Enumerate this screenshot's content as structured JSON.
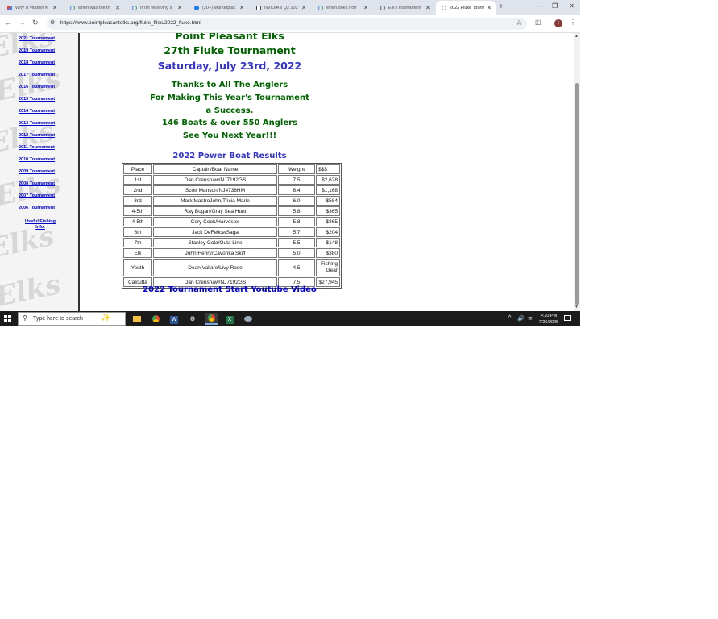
{
  "browser": {
    "tabs": [
      {
        "title": "Why is vitamin K",
        "icon": "gmail-icon"
      },
      {
        "title": "when was the th",
        "icon": "google-icon"
      },
      {
        "title": "If I'm receiving s",
        "icon": "google-icon"
      },
      {
        "title": "(20+) Marketplac",
        "icon": "facebook-icon"
      },
      {
        "title": "NVIDIA's Q2 202",
        "icon": "nvidia-icon"
      },
      {
        "title": "when does notr",
        "icon": "google-icon"
      },
      {
        "title": "Elk's tournament",
        "icon": "globe-icon"
      },
      {
        "title": "2022 Fluke Tourn",
        "icon": "globe-icon",
        "active": true
      }
    ],
    "url": "https://www.pointpleasantelks.org/fluke_files/2022_fluke.html",
    "profile_initial": "I"
  },
  "sidebar": {
    "links": [
      "2021 Tournament",
      "2019 Tournament",
      "2018 Tournament",
      "2017 Tournament",
      "2016 Tournament",
      "2015 Tournament",
      "2014 Tournament",
      "2013 Tournament",
      "2012 Tournament",
      "2011 Tournament",
      "2010 Tournament",
      "2009 Tournament",
      "2008 Tournament",
      "2007 Tournament",
      "2006 Tournament"
    ],
    "useful_line1": "Useful Fishing",
    "useful_line2": "Info.",
    "watermark": "Elks"
  },
  "content": {
    "line1": "Point Pleasant Elks",
    "line2": "27th Fluke Tournament",
    "date": "Saturday, July 23rd, 2022",
    "thanks": [
      "Thanks to All The Anglers",
      "For Making This Year's Tournament",
      "a Success.",
      "146 Boats & over 550 Anglers",
      "See You Next Year!!!"
    ],
    "results_title": "2022 Power Boat Results",
    "results_header": [
      "Place",
      "Captain/Boat Name",
      "Weight",
      "$$$"
    ],
    "results": [
      [
        "1st",
        "Dan Crenshaw/NJ7192GS",
        "7.5",
        "$2,628"
      ],
      [
        "2nd",
        "Scott Manson/NJ4736HM",
        "6.4",
        "$1,168"
      ],
      [
        "3rd",
        "Mark MastroJohn/Tricia Marie",
        "6.0",
        "$584"
      ],
      [
        "4-5th",
        "Ray Bogan/Gray Sea Hunt",
        "5.8",
        "$365"
      ],
      [
        "4-5th",
        "Cory Cook/Harvester",
        "5.8",
        "$365"
      ],
      [
        "6th",
        "Jack DeFelice/Saga",
        "5.7",
        "$204"
      ],
      [
        "7th",
        "Stanley Gola/Outa Line",
        "5.5",
        "$148"
      ],
      [
        "Elk",
        "John Henry/Cavonka Skiff",
        "5.0",
        "$380"
      ],
      [
        "Youth",
        "Dean Vallaro/Livy Rose",
        "4.5",
        "Fishing Gear"
      ],
      [
        "Calcutta",
        "Dan Crenshaw/NJ7192GS",
        "7.5",
        "$27,945"
      ]
    ],
    "video_link": "2022 Tournament Start Youtube Video"
  },
  "taskbar": {
    "search_placeholder": "Type here to search",
    "time": "4:20 PM",
    "date": "7/26/2025"
  }
}
